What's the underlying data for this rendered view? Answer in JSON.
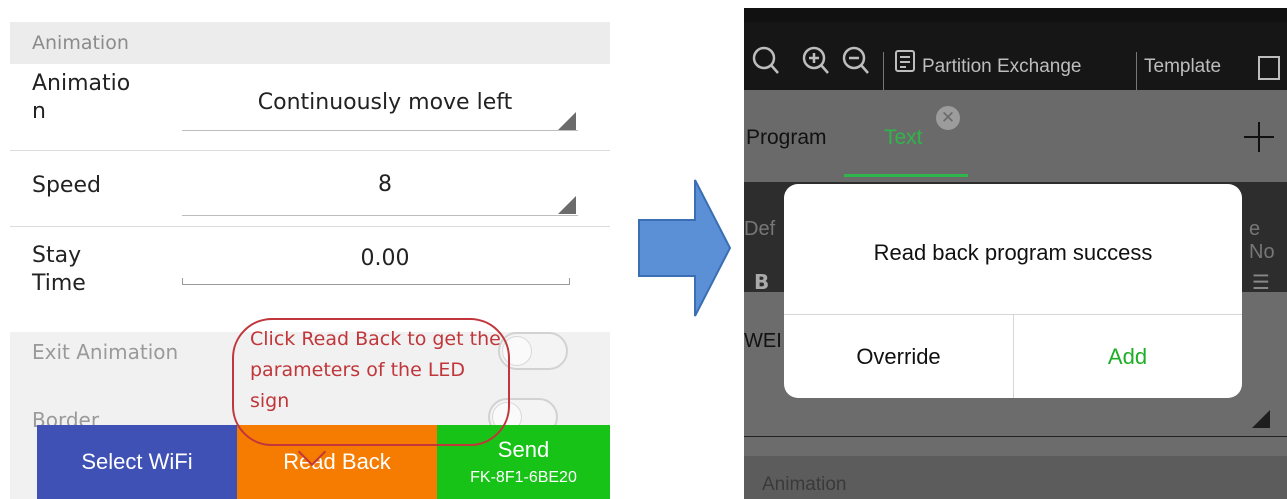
{
  "left": {
    "section_header": "Animation",
    "animation": {
      "label_line1": "Animatio",
      "label_line2": "n",
      "value": "Continuously move left"
    },
    "speed": {
      "label": "Speed",
      "value": "8"
    },
    "stay_time": {
      "label_line1": "Stay",
      "label_line2": "Time",
      "value": "0.00"
    },
    "exit_animation": {
      "label": "Exit Animation",
      "enabled": false
    },
    "border": {
      "label": "Border",
      "enabled": false
    },
    "buttons": {
      "select_wifi": "Select WiFi",
      "read_back": "Read Back",
      "send": "Send",
      "send_sub": "FK-8F1-6BE20"
    },
    "callout_text": "Click Read Back to get the parameters of the LED sign"
  },
  "right": {
    "toolbar": {
      "partition_exchange": "Partition Exchange",
      "template": "Template"
    },
    "tabs": {
      "program": "Program",
      "text": "Text"
    },
    "partial": {
      "def": "Def",
      "no": "e No",
      "bold": "B",
      "wei": "WEI"
    },
    "animation_header": "Animation",
    "dialog": {
      "message": "Read back program success",
      "override": "Override",
      "add": "Add"
    }
  },
  "colors": {
    "select_wifi": "#3f51b5",
    "read_back": "#f57c00",
    "send": "#17c317",
    "callout": "#c0363a",
    "text_tab": "#2fb64a",
    "add": "#1fae27",
    "arrow_fill": "#5b8fd6",
    "arrow_stroke": "#3a6fb3"
  }
}
